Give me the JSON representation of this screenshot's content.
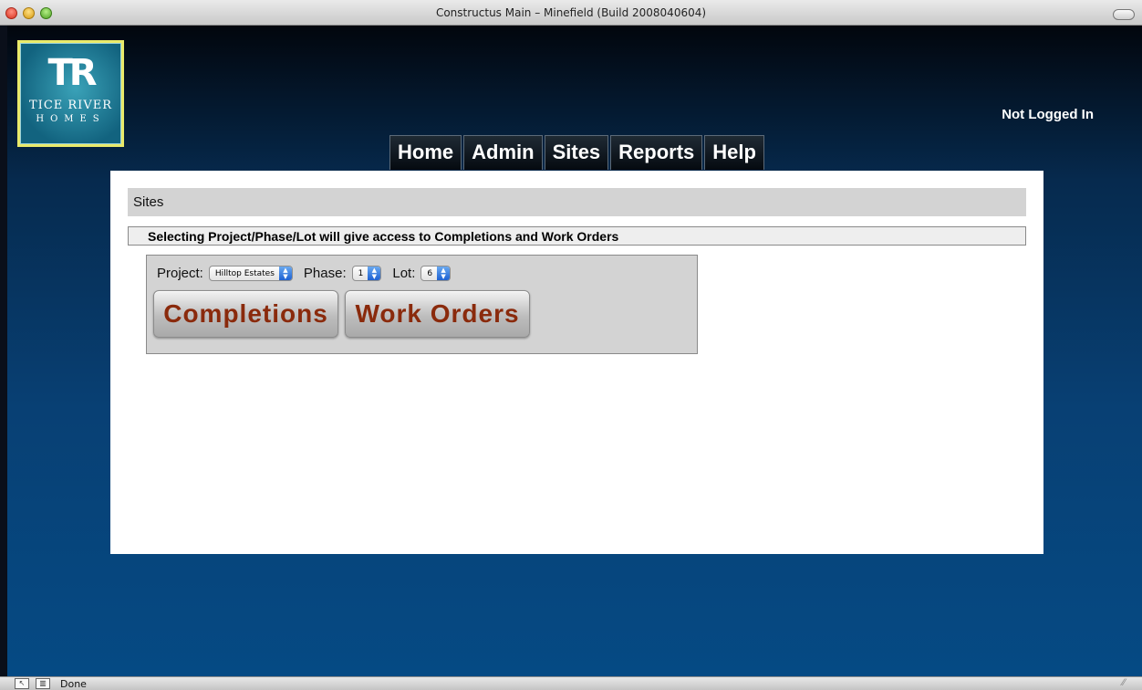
{
  "window": {
    "title": "Constructus Main – Minefield (Build 2008040604)"
  },
  "logo": {
    "mark": "TR",
    "line1": "TICE RIVER",
    "line2": "HOMES"
  },
  "header": {
    "login_status": "Not Logged In"
  },
  "nav": {
    "tabs": [
      {
        "label": "Home"
      },
      {
        "label": "Admin"
      },
      {
        "label": "Sites"
      },
      {
        "label": "Reports"
      },
      {
        "label": "Help"
      }
    ]
  },
  "main": {
    "breadcrumb": "Sites",
    "notice": "Selecting Project/Phase/Lot will give access to Completions and Work Orders",
    "selectors": {
      "project_label": "Project:",
      "project_value": "Hilltop Estates",
      "phase_label": "Phase:",
      "phase_value": "1",
      "lot_label": "Lot:",
      "lot_value": "6"
    },
    "buttons": {
      "completions": "Completions",
      "work_orders": "Work Orders"
    }
  },
  "statusbar": {
    "text": "Done"
  },
  "colors": {
    "button_text": "#8a2a0c",
    "panel_bg": "#ffffff",
    "page_bg_top": "#02060d",
    "page_bg_bottom": "#054a84"
  }
}
